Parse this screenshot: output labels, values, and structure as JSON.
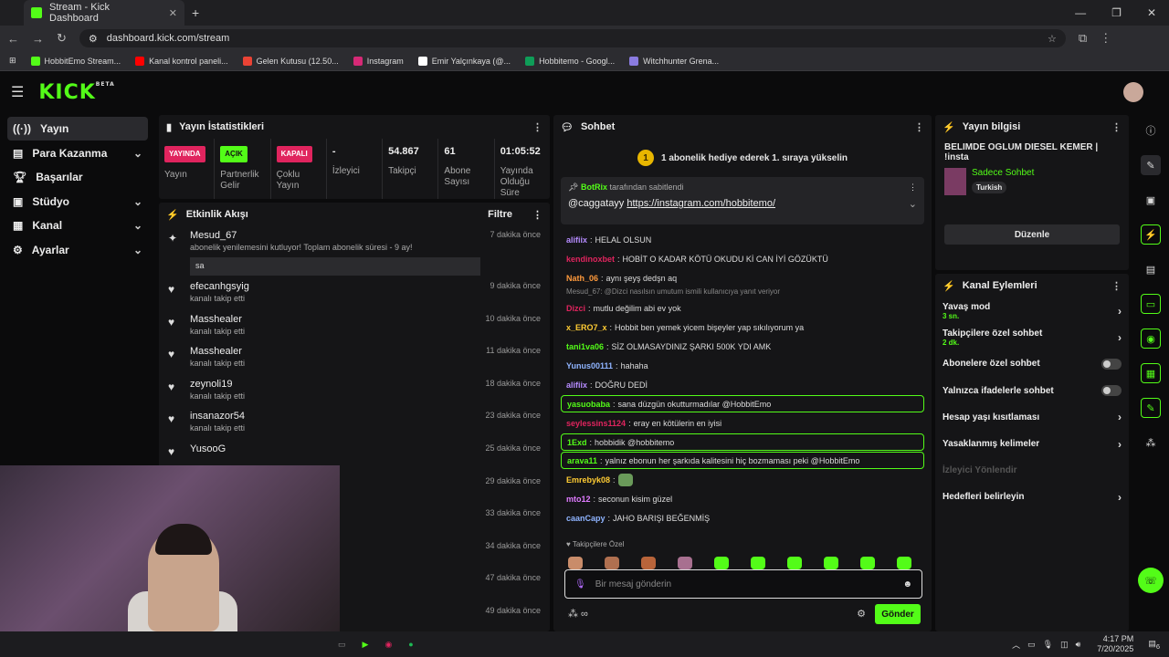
{
  "browser": {
    "tab_title": "Stream - Kick Dashboard",
    "url": "dashboard.kick.com/stream",
    "bookmarks": [
      "HobbitEmo Stream...",
      "Kanal kontrol paneli...",
      "Gelen Kutusu (12.50...",
      "Instagram",
      "Emir Yalçınkaya (@...",
      "Hobbitemo - Googl...",
      "Witchhunter Grena..."
    ]
  },
  "header": {
    "logo": "KICK",
    "beta": "BETA"
  },
  "sidebar": {
    "items": [
      {
        "label": "Yayın"
      },
      {
        "label": "Para Kazanma"
      },
      {
        "label": "Başarılar"
      },
      {
        "label": "Stüdyo"
      },
      {
        "label": "Kanal"
      },
      {
        "label": "Ayarlar"
      }
    ]
  },
  "stats": {
    "title": "Yayın İstatistikleri",
    "cols": [
      {
        "badge": "YAYINDA",
        "label": "Yayın",
        "color": "#e0245e"
      },
      {
        "badge": "AÇIK",
        "label": "Partnerlik Gelir",
        "color": "#53fc18"
      },
      {
        "badge": "KAPALI",
        "label": "Çoklu Yayın",
        "color": "#e0245e"
      },
      {
        "value": "-",
        "label": "İzleyici"
      },
      {
        "value": "54.867",
        "label": "Takipçi"
      },
      {
        "value": "61",
        "label": "Abone Sayısı"
      },
      {
        "value": "01:05:52",
        "label": "Yayında Olduğu Süre"
      }
    ]
  },
  "events": {
    "title": "Etkinlik Akışı",
    "filter": "Filtre",
    "items": [
      {
        "name": "Mesud_67",
        "sub": "abonelik yenilemesini kutluyor! Toplam abonelik süresi - 9 ay!",
        "time": "7 dakika önce",
        "msg": "sa"
      },
      {
        "name": "efecanhgsyig",
        "sub": "kanalı takip etti",
        "time": "9 dakika önce"
      },
      {
        "name": "Masshealer",
        "sub": "kanalı takip etti",
        "time": "10 dakika önce"
      },
      {
        "name": "Masshealer",
        "sub": "kanalı takip etti",
        "time": "11 dakika önce"
      },
      {
        "name": "zeynoli19",
        "sub": "kanalı takip etti",
        "time": "18 dakika önce"
      },
      {
        "name": "insanazor54",
        "sub": "kanalı takip etti",
        "time": "23 dakika önce"
      },
      {
        "name": "YusooG",
        "sub": "",
        "time": "25 dakika önce"
      },
      {
        "name": "",
        "sub": "",
        "time": "29 dakika önce"
      },
      {
        "name": "",
        "sub": "",
        "time": "33 dakika önce"
      },
      {
        "name": "",
        "sub": "",
        "time": "34 dakika önce"
      },
      {
        "name": "",
        "sub": "",
        "time": "47 dakika önce"
      },
      {
        "name": "",
        "sub": "",
        "time": "49 dakika önce"
      }
    ]
  },
  "chat": {
    "title": "Sohbet",
    "gift_text": "1 abonelik hediye ederek 1. sıraya yükselin",
    "gift_num": "1",
    "pinned_by": "BotRix",
    "pinned_suffix": "tarafından sabitlendi",
    "pinned_user": "@caggatayy",
    "pinned_link": "https://instagram.com/hobbitemo/",
    "messages": [
      {
        "user": "alifiix",
        "text": "HELAL OLSUN",
        "color": "#b68cff"
      },
      {
        "user": "kendinoxbet",
        "text": "HOBİT O KADAR KÖTÜ OKUDU Kİ CAN İYİ GÖZÜKTÜ",
        "color": "#e0245e"
      },
      {
        "user": "Nath_06",
        "text": "aynı şeyş dedşn aq",
        "color": "#ff9a3c"
      },
      {
        "reply": "Mesud_67: @Dizci nasılsın umutum ismili kullanıcıya yanıt veriyor",
        "user": "Dizci",
        "text": "mutlu değilim abi ev yok",
        "color": "#e0245e"
      },
      {
        "user": "x_ERO7_x",
        "text": "Hobbit ben yemek yicem bişeyler yap sıkılıyorum ya",
        "color": "#ffcc33"
      },
      {
        "user": "tani1va06",
        "text": "SİZ OLMASAYDINIZ ŞARKI 500K YDI AMK",
        "color": "#53fc18"
      },
      {
        "user": "Yunus00111",
        "text": "hahaha",
        "color": "#8fb4ff"
      },
      {
        "user": "alifiix",
        "text": "DOĞRU DEDİ",
        "color": "#b68cff"
      },
      {
        "user": "yasuobaba",
        "text": "sana düzgün okutturmadılar @HobbitEmo",
        "color": "#53fc18",
        "hl": true
      },
      {
        "user": "seylessins1124",
        "text": "eray en kötülerin en iyisi",
        "color": "#e0245e"
      },
      {
        "user": "1Exd",
        "text": "hobbidik @hobbitemo",
        "color": "#53fc18",
        "hl": true
      },
      {
        "user": "arava11",
        "text": "yalnız ebonun her şarkıda kalitesini hiç bozmaması peki @HobbitEmo",
        "color": "#53fc18",
        "hl": true
      },
      {
        "user": "Emrebyk08",
        "text": "",
        "color": "#ffcc33"
      },
      {
        "user": "mto12",
        "text": "seconun kisim güzel",
        "color": "#e07bff"
      },
      {
        "user": "caanCapy",
        "text": "JAHO BARIŞI BEĞENMİŞ",
        "color": "#8fb4ff"
      }
    ],
    "followers_only_label": "Takipçilere Özel",
    "placeholder": "Bir mesaj gönderin",
    "send": "Gönder"
  },
  "info": {
    "title": "Yayın bilgisi",
    "stream_title": "BELIMDE OGLUM DIESEL KEMER | !insta",
    "category": "Sadece Sohbet",
    "tag": "Turkish",
    "edit": "Düzenle"
  },
  "actions": {
    "title": "Kanal Eylemleri",
    "items": [
      {
        "label": "Yavaş mod",
        "sub": "3 sn.",
        "type": "chev"
      },
      {
        "label": "Takipçilere özel sohbet",
        "sub": "2 dk.",
        "type": "chev"
      },
      {
        "label": "Abonelere özel sohbet",
        "sub": "",
        "type": "toggle"
      },
      {
        "label": "Yalnızca ifadelerle sohbet",
        "sub": "",
        "type": "toggle"
      },
      {
        "label": "Hesap yaşı kısıtlaması",
        "sub": "",
        "type": "chev"
      },
      {
        "label": "Yasaklanmış kelimeler",
        "sub": "",
        "type": "chev"
      },
      {
        "label": "İzleyici Yönlendir",
        "sub": "",
        "type": "disabled"
      },
      {
        "label": "Hedefleri belirleyin",
        "sub": "",
        "type": "chev"
      }
    ]
  },
  "taskbar": {
    "time": "4:17 PM",
    "date": "7/20/2025",
    "notif": "6"
  }
}
